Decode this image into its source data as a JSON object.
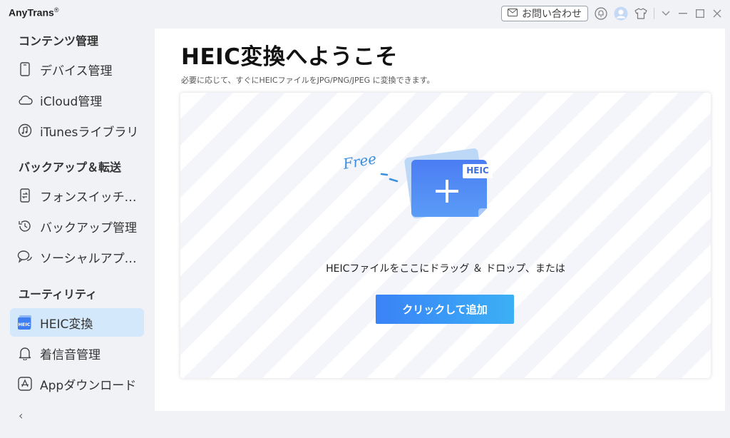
{
  "app": {
    "title": "AnyTrans",
    "trademark": "®"
  },
  "titlebar": {
    "contact_label": "お問い合わせ"
  },
  "sidebar": {
    "sections": [
      {
        "title": "コンテンツ管理"
      },
      {
        "title": "バックアップ＆転送"
      },
      {
        "title": "ユーティリティ"
      }
    ],
    "items": [
      {
        "label": "デバイス管理",
        "icon": "phone-icon"
      },
      {
        "label": "iCloud管理",
        "icon": "cloud-icon"
      },
      {
        "label": "iTunesライブラリ",
        "icon": "music-icon"
      },
      {
        "label": "フォンスイッチャー",
        "icon": "phone-switch-icon"
      },
      {
        "label": "バックアップ管理",
        "icon": "history-icon"
      },
      {
        "label": "ソーシャルアプリの...",
        "icon": "chat-icon"
      },
      {
        "label": "HEIC変換",
        "icon": "heic-icon",
        "active": true
      },
      {
        "label": "着信音管理",
        "icon": "bell-icon"
      },
      {
        "label": "Appダウンロード",
        "icon": "app-store-icon"
      }
    ],
    "collapse_symbol": "‹"
  },
  "main": {
    "title": "HEIC変換へようこそ",
    "subtitle": "必要に応じて、すぐにHEICファイルをJPG/PNG/JPEG に変換できます。",
    "illustration": {
      "free_label": "Free",
      "badge_label": "HEIC",
      "plus_symbol": "+"
    },
    "drop_text": "HEICファイルをここにドラッグ ＆ ドロップ、または",
    "add_button_label": "クリックして追加"
  },
  "colors": {
    "accent": "#3a82f7",
    "active_bg": "#d4e8fb",
    "folder_blue": "#4a7ef2",
    "free_blue": "#3a8fe0"
  }
}
